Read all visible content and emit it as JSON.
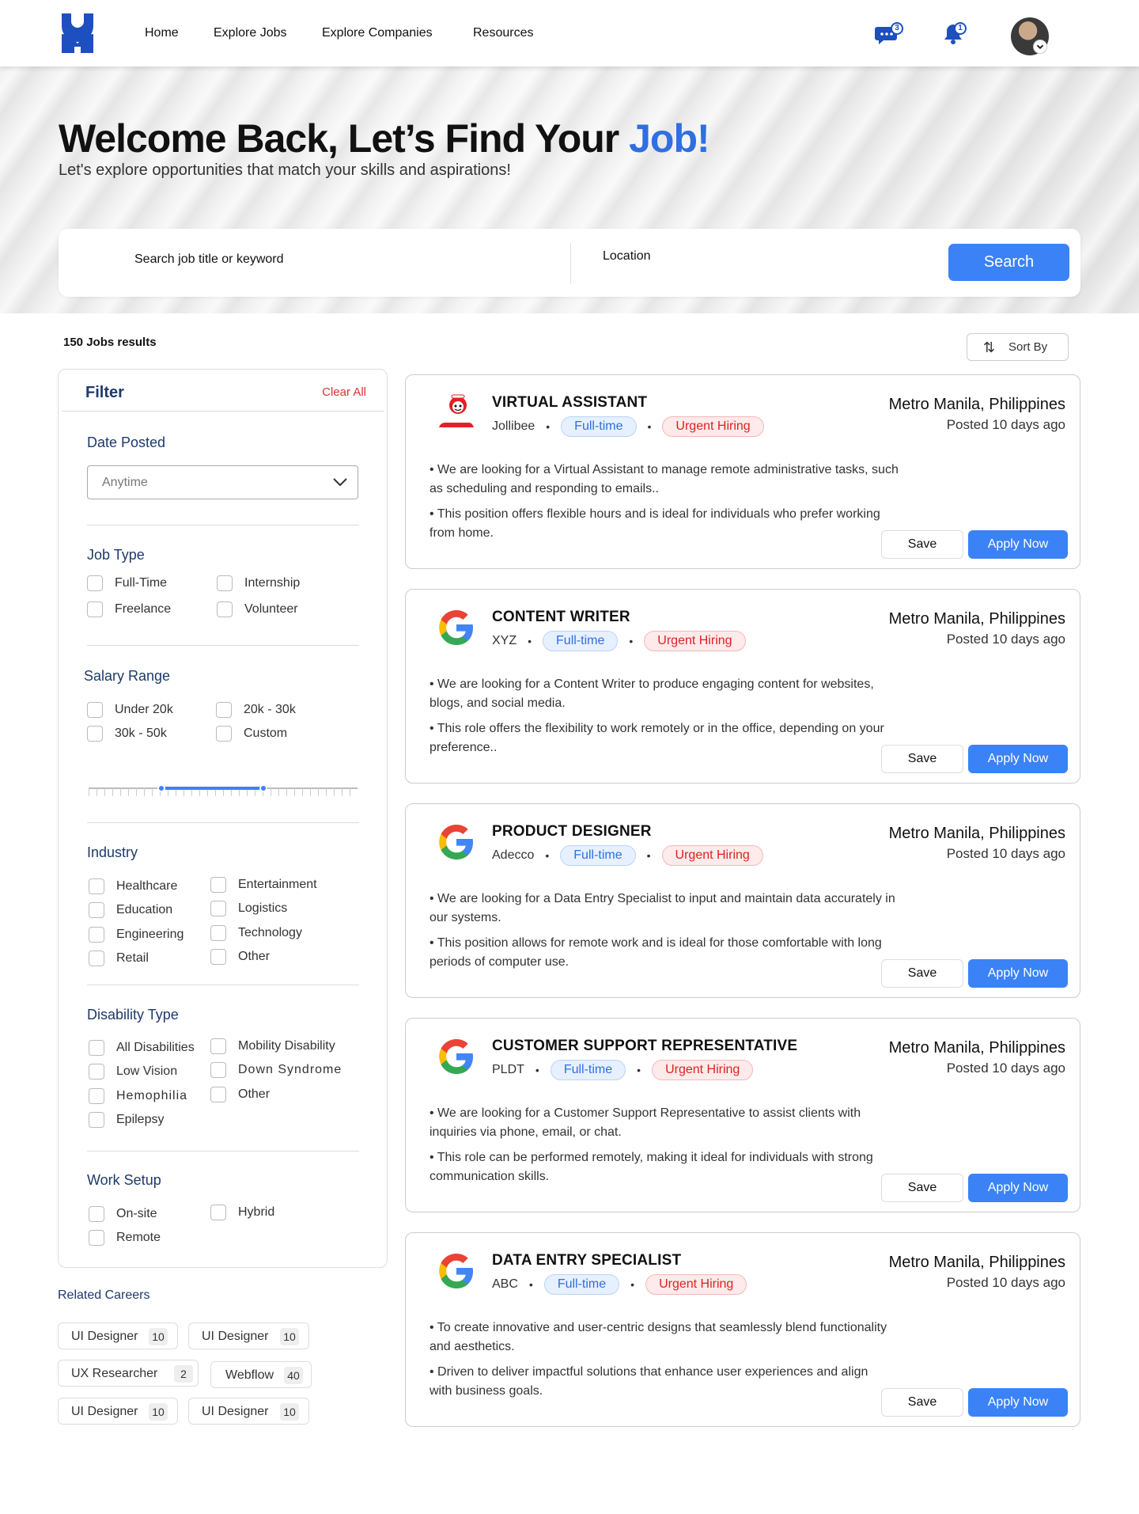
{
  "nav": {
    "links": [
      "Home",
      "Explore Jobs",
      "Explore Companies",
      "Resources"
    ],
    "messages_count": "3",
    "notifications_count": "1",
    "brand_color": "#1d4fbf"
  },
  "hero": {
    "title_main": "Welcome Back, Let’s Find Your ",
    "title_accent": "Job!",
    "subtitle": "Let's explore opportunities that match your skills and aspirations!",
    "search_placeholder": "Search job title or keyword",
    "location_placeholder": "Location",
    "search_button": "Search"
  },
  "results": {
    "count_label": "150 Jobs results",
    "sort_label": "Sort By"
  },
  "filter": {
    "title": "Filter",
    "clear_all": "Clear All",
    "date_posted": {
      "title": "Date Posted",
      "selected": "Anytime"
    },
    "job_type": {
      "title": "Job Type",
      "options": [
        "Full-Time",
        "Internship",
        "Freelance",
        "Volunteer"
      ]
    },
    "salary_range": {
      "title": "Salary Range",
      "options": [
        "Under 20k",
        "20k - 30k",
        "30k - 50k",
        "Custom"
      ],
      "slider_min_fraction": 0.27,
      "slider_max_fraction": 0.65
    },
    "industry": {
      "title": "Industry",
      "options": [
        "Healthcare",
        "Entertainment",
        "Education",
        "Logistics",
        "Engineering",
        "Technology",
        "Retail",
        "Other"
      ]
    },
    "disability_type": {
      "title": "Disability Type",
      "options": [
        "All Disabilities",
        "Mobility Disability",
        "Low Vision",
        "Down Syndrome",
        "Hemophilia",
        "Other",
        "Epilepsy"
      ]
    },
    "work_setup": {
      "title": "Work Setup",
      "options": [
        "On-site",
        "Hybrid",
        "Remote"
      ]
    }
  },
  "related": {
    "title": "Related Careers",
    "chips": [
      {
        "label": "UI Designer",
        "count": "10"
      },
      {
        "label": "UI Designer",
        "count": "10"
      },
      {
        "label": "UX Researcher",
        "count": "2"
      },
      {
        "label": "Webflow",
        "count": "40"
      },
      {
        "label": "UI Designer",
        "count": "10"
      },
      {
        "label": "UI Designer",
        "count": "10"
      }
    ]
  },
  "jobs": [
    {
      "title": "VIRTUAL ASSISTANT",
      "company": "Jollibee",
      "logo": "jollibee-logo",
      "type": "Full-time",
      "tag": "Urgent Hiring",
      "location": "Metro Manila, Philippines",
      "posted": "Posted  10 days ago",
      "bullets": [
        "•  We are looking for a Virtual Assistant to manage remote administrative tasks, such as scheduling and responding to emails..",
        "•  This position offers flexible hours and is ideal for individuals who prefer working from home."
      ],
      "save": "Save",
      "apply": "Apply Now"
    },
    {
      "title": "CONTENT WRITER",
      "company": "XYZ",
      "logo": "google-logo",
      "type": "Full-time",
      "tag": "Urgent Hiring",
      "location": "Metro Manila, Philippines",
      "posted": "Posted  10 days ago",
      "bullets": [
        "•  We are looking for a Content Writer to produce engaging content for websites, blogs, and social media.",
        "•  This role offers the flexibility to work remotely or in the office, depending on your preference.."
      ],
      "save": "Save",
      "apply": "Apply Now"
    },
    {
      "title": "PRODUCT DESIGNER",
      "company": "Adecco",
      "logo": "google-logo",
      "type": "Full-time",
      "tag": "Urgent Hiring",
      "location": "Metro Manila, Philippines",
      "posted": "Posted  10 days ago",
      "bullets": [
        "•  We are looking for a Data Entry Specialist to input and maintain data accurately in our systems.",
        "• This position allows for remote work and is ideal for those comfortable with long periods of computer use."
      ],
      "save": "Save",
      "apply": "Apply Now"
    },
    {
      "title": "CUSTOMER SUPPORT REPRESENTATIVE",
      "company": "PLDT",
      "logo": "google-logo",
      "type": "Full-time",
      "tag": "Urgent Hiring",
      "location": "Metro Manila, Philippines",
      "posted": "Posted  10 days ago",
      "bullets": [
        "•  We are looking for a Customer Support Representative to assist clients with inquiries via phone, email, or chat.",
        "•  This role can be performed remotely, making it ideal for individuals with strong communication skills."
      ],
      "save": "Save",
      "apply": "Apply Now"
    },
    {
      "title": "DATA ENTRY SPECIALIST",
      "company": "ABC",
      "logo": "google-logo",
      "type": "Full-time",
      "tag": "Urgent Hiring",
      "location": "Metro Manila, Philippines",
      "posted": "Posted  10 days ago",
      "bullets": [
        "•  To create innovative and user-centric designs that seamlessly blend functionality and aesthetics.",
        "•  Driven to deliver impactful solutions that enhance user experiences and align with business goals."
      ],
      "save": "Save",
      "apply": "Apply Now"
    }
  ]
}
